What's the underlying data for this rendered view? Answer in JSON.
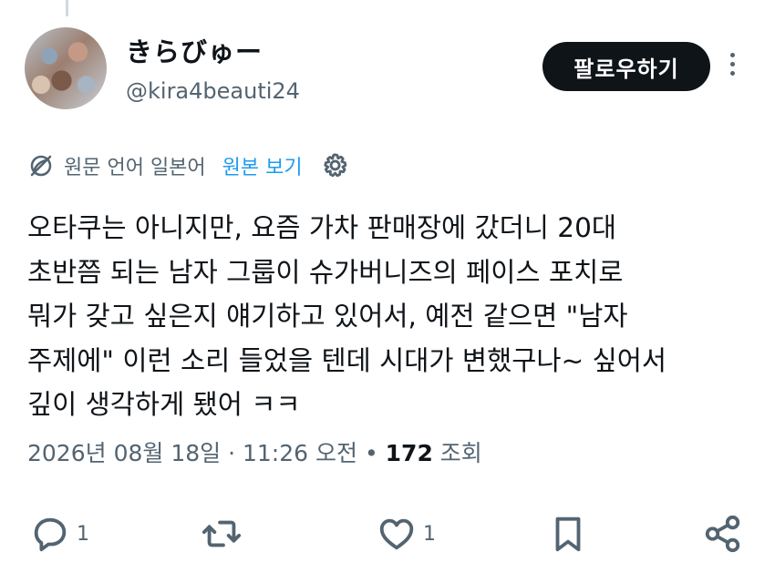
{
  "header": {
    "display_name": "きらびゅー",
    "handle": "@kira4beauti24",
    "follow_label": "팔로우하기",
    "more_icon": "more-vertical-icon"
  },
  "translation": {
    "label": "원문 언어 일본어",
    "view_original": "원본 보기",
    "icons": [
      "globe-slash-icon",
      "gear-icon"
    ]
  },
  "tweet": {
    "text": "오타쿠는 아니지만, 요즘 가차 판매장에 갔더니 20대\n초반쯤 되는 남자 그룹이 슈가버니즈의 페이스 포치로\n뭐가 갖고 싶은지 얘기하고 있어서, 예전 같으면 \"남자\n주제에\" 이런 소리 들었을 텐데 시대가 변했구나~ 싶어서\n깊이 생각하게 됐어 ㅋㅋ"
  },
  "meta": {
    "date": "2026년 08월 18일",
    "separator1": "·",
    "time": "11:26 오전",
    "separator2": "•",
    "views_count": "172",
    "views_label": "조회"
  },
  "actions": {
    "reply_count": "1",
    "like_count": "1",
    "icons": [
      "reply-icon",
      "retweet-icon",
      "like-icon",
      "bookmark-icon",
      "share-icon"
    ]
  },
  "colors": {
    "text": "#0f1419",
    "secondary": "#536471",
    "link": "#1d9bf0",
    "button_bg": "#0f1419"
  }
}
